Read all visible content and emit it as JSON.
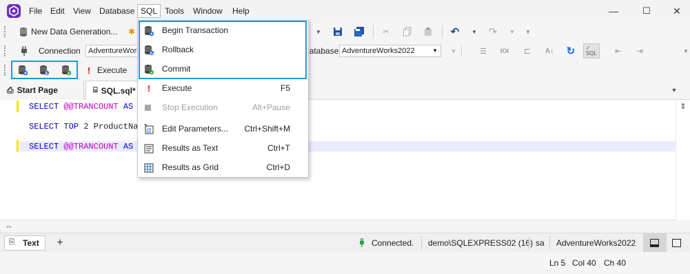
{
  "menubar": {
    "items": [
      "File",
      "Edit",
      "View",
      "Database",
      "SQL",
      "Tools",
      "Window",
      "Help"
    ],
    "active": "SQL"
  },
  "window_controls": {
    "minimize": "—",
    "maximize": "☐",
    "close": "✕"
  },
  "toolbar1": {
    "new_data_generation": "New Data Generation..."
  },
  "toolbar2": {
    "connection_label": "Connection",
    "connection_value": "AdventureWorks",
    "database_label": "Database",
    "database_value": "AdventureWorks2022"
  },
  "toolbar3": {
    "execute_label": "Execute"
  },
  "tabs": [
    {
      "label": "Start Page"
    },
    {
      "label": "SQL.sql*"
    }
  ],
  "editor": {
    "lines": [
      {
        "kw": "SELECT ",
        "var": "@@TRANCOUNT",
        "rest": " AS T"
      },
      {
        "kw": "SELECT TOP ",
        "num": "2",
        "rest": " ProductNam"
      },
      {
        "kw": "SELECT ",
        "var": "@@TRANCOUNT",
        "rest": " AS T"
      }
    ]
  },
  "sql_menu": {
    "items": [
      {
        "label": "Begin Transaction",
        "shortcut": "",
        "icon": "begin-transaction-icon"
      },
      {
        "label": "Rollback",
        "shortcut": "",
        "icon": "rollback-icon"
      },
      {
        "label": "Commit",
        "shortcut": "",
        "icon": "commit-icon"
      },
      {
        "label": "Execute",
        "shortcut": "F5",
        "icon": "execute-icon"
      },
      {
        "label": "Stop Execution",
        "shortcut": "Alt+Pause",
        "icon": "stop-icon",
        "disabled": true
      },
      {
        "label": "Edit Parameters...",
        "shortcut": "Ctrl+Shift+M",
        "icon": "edit-parameters-icon"
      },
      {
        "label": "Results as Text",
        "shortcut": "Ctrl+T",
        "icon": "results-text-icon"
      },
      {
        "label": "Results as Grid",
        "shortcut": "Ctrl+D",
        "icon": "results-grid-icon"
      }
    ]
  },
  "status": {
    "output_tab": "Text",
    "connection_status": "Connected.",
    "server": "demo\\SQLEXPRESS02 (16)",
    "user": "sa",
    "database": "AdventureWorks2022"
  },
  "position": {
    "line": "Ln 5",
    "col": "Col 40",
    "ch": "Ch 40"
  },
  "colors": {
    "highlight": "#1d9bd7",
    "keyword": "#0000cc",
    "variable": "#c000c0",
    "marker": "#f2e500"
  }
}
